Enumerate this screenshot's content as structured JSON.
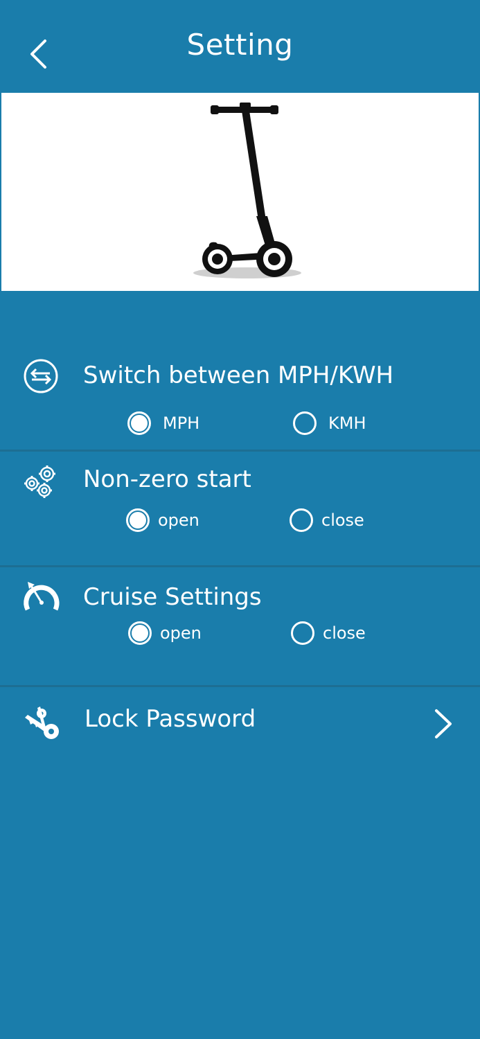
{
  "header": {
    "title": "Setting",
    "back_icon": "chevron-left-icon"
  },
  "hero": {
    "image": "electric-scooter"
  },
  "units": {
    "title_left": "Switch between",
    "title_right": "MPH/KWH",
    "icon": "switch-arrows-icon",
    "options": [
      {
        "label": "MPH",
        "selected": true
      },
      {
        "label": "KMH",
        "selected": false
      }
    ]
  },
  "nonzero": {
    "title": "Non-zero start",
    "icon": "gears-icon",
    "options": [
      {
        "label": "open",
        "selected": true
      },
      {
        "label": "close",
        "selected": false
      }
    ]
  },
  "cruise": {
    "title": "Cruise Settings",
    "icon": "speedometer-icon",
    "options": [
      {
        "label": "open",
        "selected": true
      },
      {
        "label": "close",
        "selected": false
      }
    ]
  },
  "lock": {
    "title": "Lock Password",
    "icon": "keys-icon",
    "chevron_icon": "chevron-right-icon"
  },
  "colors": {
    "background": "#1a7dab",
    "divider": "#1d6e93",
    "foreground": "#ffffff"
  }
}
